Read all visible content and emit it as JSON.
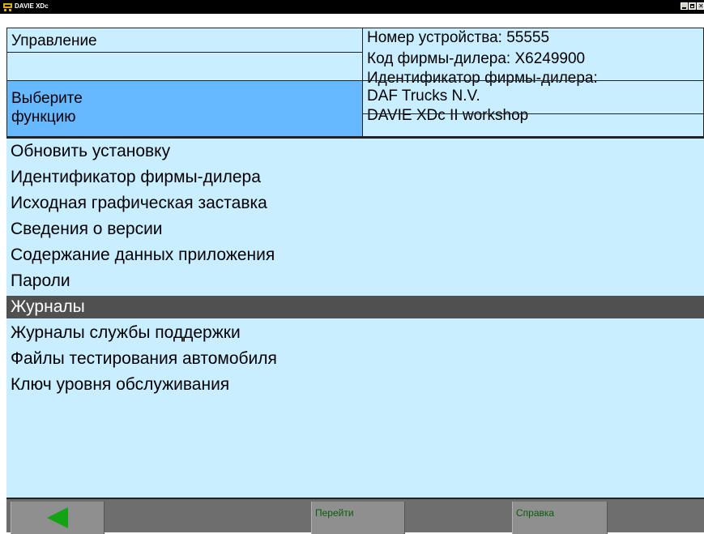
{
  "window": {
    "title": "DAVIE XDc"
  },
  "header": {
    "section_title": "Управление",
    "prompt_line1": "Выберите",
    "prompt_line2": "функцию",
    "device_number": "Номер устройства:   55555",
    "dealer_code": "Код фирмы-дилера:   X6249900",
    "dealer_id_label": "Идентификатор фирмы-дилера:",
    "dealer_name": "DAF Trucks N.V.",
    "workshop": "DAVIE XDc II workshop"
  },
  "menu": {
    "items": [
      {
        "label": "Обновить установку"
      },
      {
        "label": "Идентификатор фирмы-дилера"
      },
      {
        "label": "Исходная графическая заставка"
      },
      {
        "label": "Сведения о версии"
      },
      {
        "label": "Содержание данных приложения"
      },
      {
        "label": "Пароли"
      },
      {
        "label": "Журналы"
      },
      {
        "label": "Журналы службы поддержки"
      },
      {
        "label": "Файлы тестирования автомобиля"
      },
      {
        "label": "Ключ уровня обслуживания"
      }
    ],
    "selected_index": 6
  },
  "footer": {
    "back_icon": "back-arrow-icon",
    "go_label": "Перейти",
    "help_label": "Справка"
  },
  "colors": {
    "panel_bg": "#c8eeff",
    "prompt_bg": "#66b8ff",
    "selected_bg": "#505050",
    "footer_bg": "#6e6e6e",
    "fkey_bg": "#8f8f8f",
    "fkey_text": "#0a5c0a",
    "arrow": "#14a314"
  }
}
